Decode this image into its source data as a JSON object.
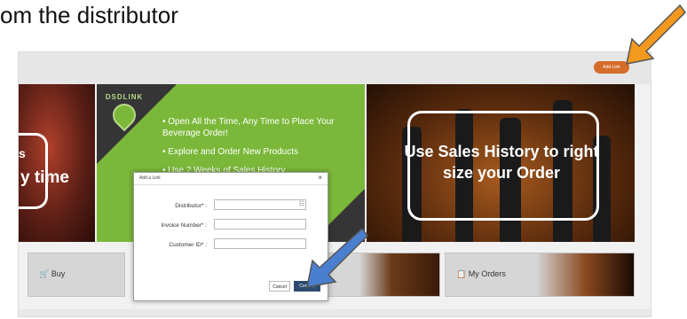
{
  "caption": "om the distributor",
  "toolbar": {
    "add_link_label": "Add Link"
  },
  "banners": {
    "left_text_top": "s",
    "left_text": "y time",
    "logo_text": "DSDLINK",
    "bullets": [
      "• Open All the Time, Any Time to Place Your Beverage Order!",
      "• Explore and Order New Products",
      "• Use 2 Weeks of Sales History"
    ],
    "right_text": "Use Sales History to right size your Order"
  },
  "cards": [
    {
      "label": "Buy",
      "icon": "cart-icon"
    },
    {
      "label": "My Orders",
      "icon": "orders-icon"
    }
  ],
  "modal": {
    "title": "Add a Link",
    "close": "×",
    "fields": [
      {
        "label": "Distributor* :",
        "value": ""
      },
      {
        "label": "Invoice Number* :",
        "value": ""
      },
      {
        "label": "Customer ID* :",
        "value": ""
      }
    ],
    "cancel_label": "Cancel",
    "confirm_label": "Confirm"
  },
  "colors": {
    "accent": "#d46c2a",
    "confirm": "#2d4b6e",
    "orange_arrow": "#f39a1e",
    "blue_arrow": "#4a7fd0"
  }
}
